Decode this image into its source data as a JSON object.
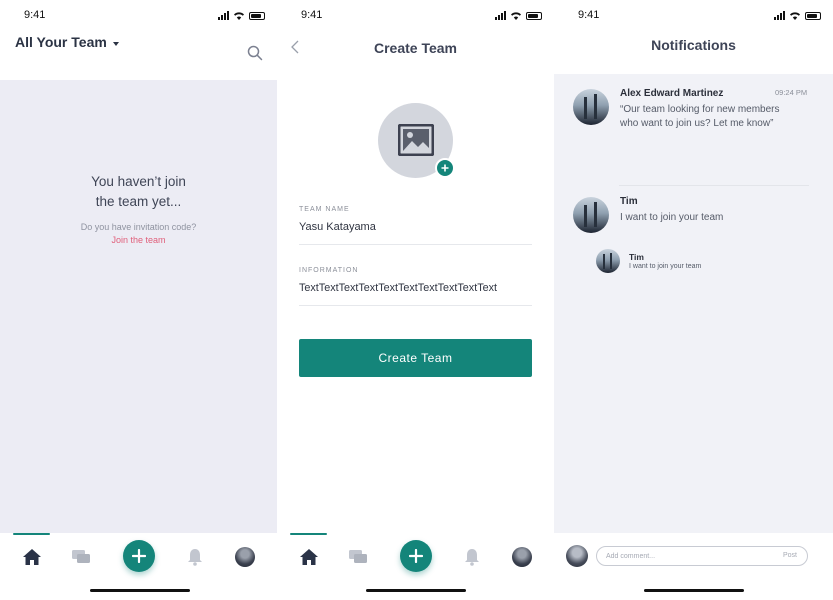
{
  "status_time": "9:41",
  "screen1": {
    "title": "All Your Team",
    "empty_title_line1": "You haven’t join",
    "empty_title_line2": "the team yet...",
    "empty_sub": "Do you have invitation code?",
    "empty_link": "Join the team"
  },
  "screen2": {
    "title": "Create Team",
    "team_name_label": "TEAM NAME",
    "team_name_value": "Yasu Katayama",
    "information_label": "INFORMATION",
    "information_value": "TextTextTextTextTextTextTextTextTextText",
    "create_button": "Create Team"
  },
  "screen3": {
    "title": "Notifications",
    "notifications": [
      {
        "name": "Alex Edward Martinez",
        "time": "09:24 PM",
        "message_line1": "“Our team looking for new members",
        "message_line2": "who want to join us? Let me know”"
      },
      {
        "name": "Tim",
        "message": "I want to join your team"
      },
      {
        "name": "Tim",
        "message": "I want to join your team"
      }
    ],
    "comment_placeholder": "Add comment...",
    "post_label": "Post"
  },
  "colors": {
    "accent": "#14857a",
    "link": "#e0607b"
  },
  "tabs": [
    "home-icon",
    "chat-icon",
    "add-icon",
    "bell-icon",
    "profile-avatar"
  ]
}
